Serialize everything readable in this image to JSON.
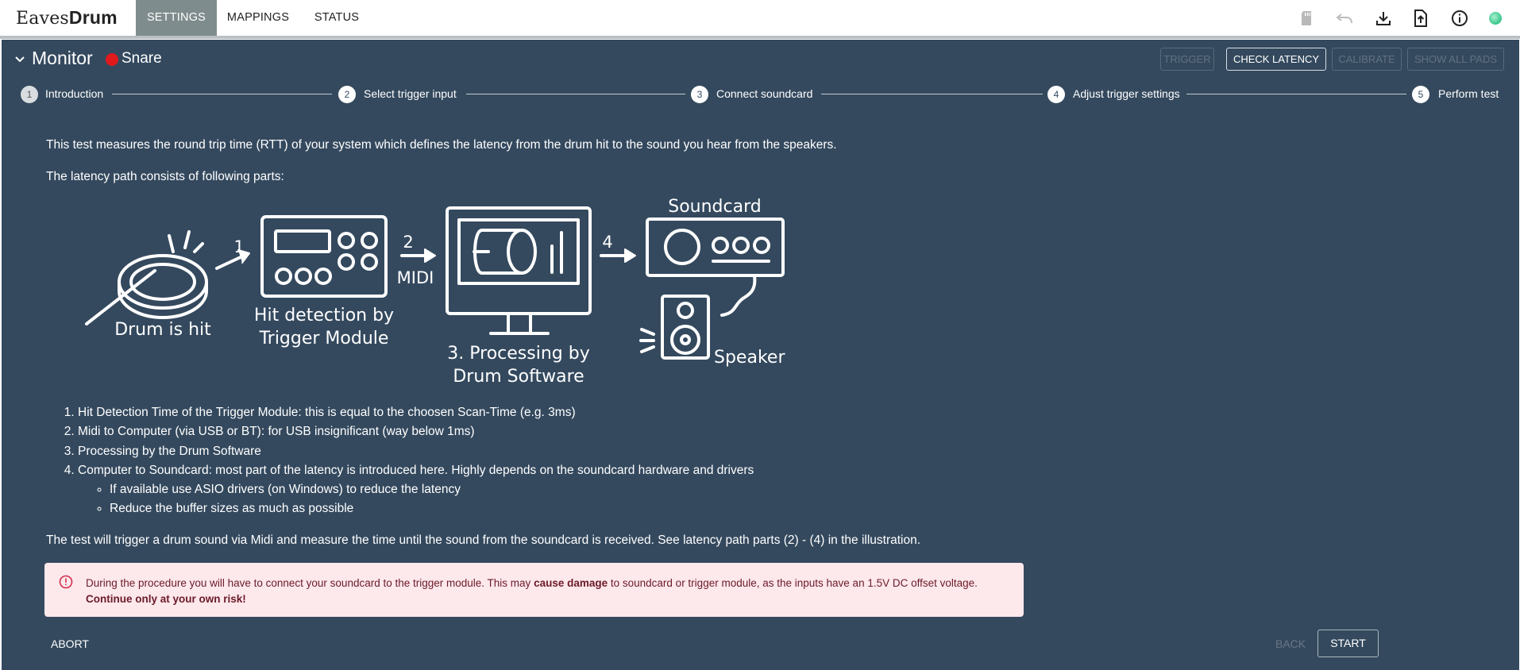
{
  "app": {
    "logo_light": "Eaves",
    "logo_bold": "Drum"
  },
  "nav": {
    "tabs": [
      {
        "label": "SETTINGS",
        "active": true
      },
      {
        "label": "MAPPINGS",
        "active": false
      },
      {
        "label": "STATUS",
        "active": false
      }
    ]
  },
  "toolbar": {
    "icons": [
      "sd-card-icon",
      "undo-icon",
      "download-icon",
      "upload-file-icon",
      "info-icon",
      "connection-status-icon"
    ],
    "status_color": "#4cd39b"
  },
  "monitor": {
    "title": "Monitor",
    "pad_name": "Snare",
    "pad_color": "#e0191d",
    "buttons": {
      "trigger": "TRIGGER",
      "check_latency": "CHECK LATENCY",
      "calibrate": "CALIBRATE",
      "show_all_pads": "SHOW ALL PADS"
    }
  },
  "stepper": {
    "steps": [
      {
        "number": "1",
        "label": "Introduction"
      },
      {
        "number": "2",
        "label": "Select trigger input"
      },
      {
        "number": "3",
        "label": "Connect soundcard"
      },
      {
        "number": "4",
        "label": "Adjust trigger settings"
      },
      {
        "number": "5",
        "label": "Perform test"
      }
    ]
  },
  "content": {
    "intro": "This test measures the round trip time (RTT) of your system which defines the latency from the drum hit to the sound you hear from the speakers.",
    "path_intro": "The latency path consists of following parts:",
    "diagram": {
      "drum_label": "Drum is hit",
      "step1": "1",
      "module_label_1": "Hit detection by",
      "module_label_2": "Trigger Module",
      "step2": "2",
      "midi": "MIDI",
      "processing_label_1": "3. Processing by",
      "processing_label_2": "Drum Software",
      "step4": "4",
      "soundcard_label": "Soundcard",
      "speaker_label": "Speaker"
    },
    "parts": [
      "Hit Detection Time of the Trigger Module: this is equal to the choosen Scan-Time (e.g. 3ms)",
      "Midi to Computer (via USB or BT): for USB insignificant (way below 1ms)",
      "Processing by the Drum Software",
      "Computer to Soundcard: most part of the latency is introduced here. Highly depends on the soundcard hardware and drivers"
    ],
    "subparts": [
      "If available use ASIO drivers (on Windows) to reduce the latency",
      "Reduce the buffer sizes as much as possible"
    ],
    "test_description": "The test will trigger a drum sound via Midi and measure the time until the sound from the soundcard is received. See latency path parts (2) - (4) in the illustration."
  },
  "alert": {
    "text_before": "During the procedure you will have to connect your soundcard to the trigger module. This may ",
    "text_bold": "cause damage",
    "text_after": " to soundcard or trigger module, as the inputs have an 1.5V DC offset voltage.",
    "warning": "Continue only at your own risk!"
  },
  "footer": {
    "abort": "ABORT",
    "back": "BACK",
    "start": "START"
  }
}
